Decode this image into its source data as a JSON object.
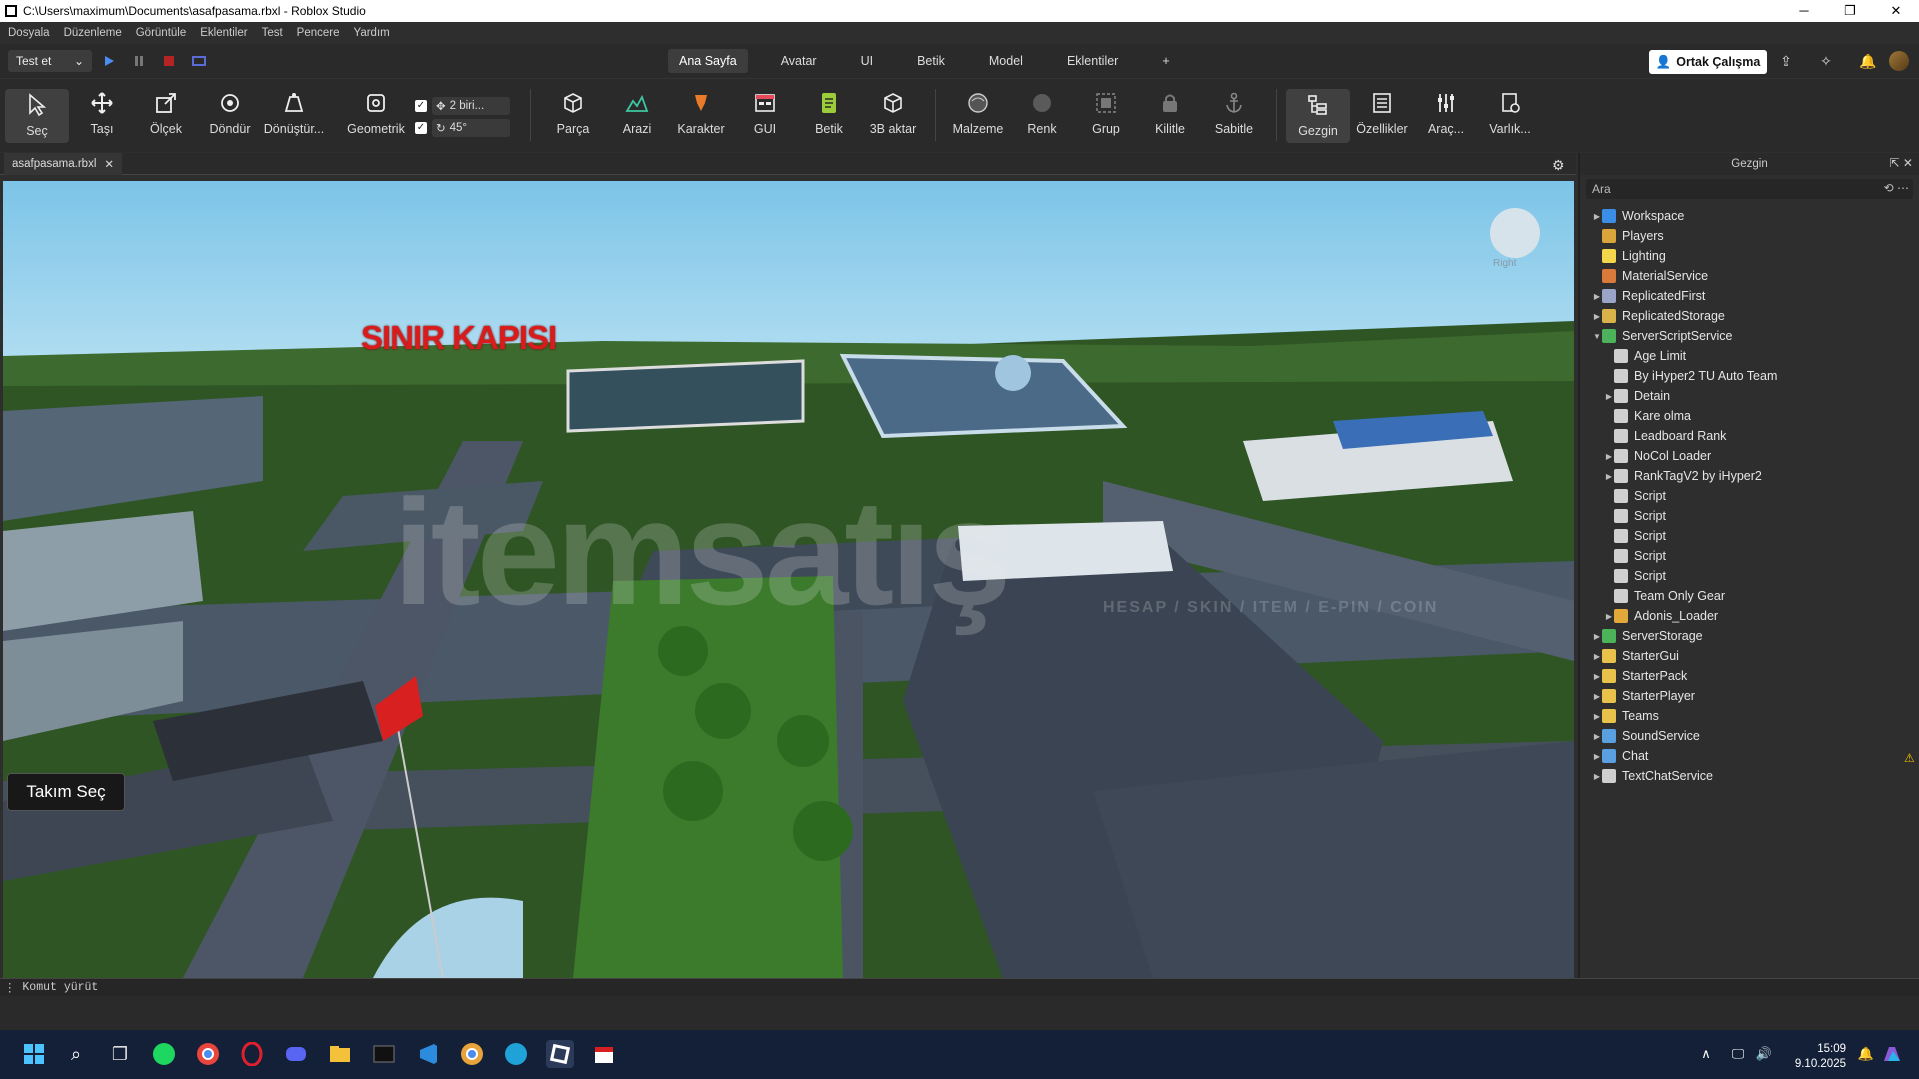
{
  "window": {
    "title": "C:\\Users\\maximum\\Documents\\asafpasama.rbxl - Roblox Studio",
    "min": "─",
    "max": "❐",
    "close": "✕"
  },
  "menu": [
    "Dosyala",
    "Düzenleme",
    "Görüntüle",
    "Eklentiler",
    "Test",
    "Pencere",
    "Yardım"
  ],
  "topbar": {
    "test_dropdown": "Test et",
    "tabs": [
      "Ana Sayfa",
      "Avatar",
      "UI",
      "Betik",
      "Model",
      "Eklentiler",
      "+"
    ],
    "active_tab": "Ana Sayfa",
    "collab_button": "Ortak Çalışma"
  },
  "ribbon": {
    "tools": [
      "Seç",
      "Taşı",
      "Ölçek",
      "Döndür",
      "Dönüştür...",
      "Geometrik"
    ],
    "snap": {
      "move_value": "2 biri...",
      "rotate_value": "45°"
    },
    "insert": [
      "Parça",
      "Arazi",
      "Karakter",
      "GUI",
      "Betik",
      "3B aktar"
    ],
    "edit": [
      "Malzeme",
      "Renk",
      "Grup",
      "Kilitle",
      "Sabitle"
    ],
    "panels": [
      "Gezgin",
      "Özellikler",
      "Araç...",
      "Varlık..."
    ]
  },
  "document_tab": {
    "name": "asafpasama.rbxl",
    "close": "✕"
  },
  "viewport": {
    "sign_text": "SINIR KAPISI",
    "team_button": "Takım Seç",
    "watermark": "itemsatış",
    "watermark_sub": "HESAP / SKIN / ITEM / E-PIN / COIN",
    "view_cube": "Right"
  },
  "explorer": {
    "title": "Gezgin",
    "search_placeholder": "Ara",
    "items": [
      {
        "label": "Workspace",
        "depth": 0,
        "arrow": "▶",
        "color": "#3a8ee6"
      },
      {
        "label": "Players",
        "depth": 0,
        "arrow": "",
        "color": "#d9a43a"
      },
      {
        "label": "Lighting",
        "depth": 0,
        "arrow": "",
        "color": "#f2d64b"
      },
      {
        "label": "MaterialService",
        "depth": 0,
        "arrow": "",
        "color": "#d87b3a"
      },
      {
        "label": "ReplicatedFirst",
        "depth": 0,
        "arrow": "▶",
        "color": "#9aa4c8"
      },
      {
        "label": "ReplicatedStorage",
        "depth": 0,
        "arrow": "▶",
        "color": "#d9b24a"
      },
      {
        "label": "ServerScriptService",
        "depth": 0,
        "arrow": "▼",
        "color": "#4db35a"
      },
      {
        "label": "Age Limit",
        "depth": 1,
        "arrow": "",
        "color": "#cfcfcf"
      },
      {
        "label": "By iHyper2 TU Auto Team",
        "depth": 1,
        "arrow": "",
        "color": "#cfcfcf"
      },
      {
        "label": "Detain",
        "depth": 1,
        "arrow": "▶",
        "color": "#cfcfcf"
      },
      {
        "label": "Kare olma",
        "depth": 1,
        "arrow": "",
        "color": "#cfcfcf"
      },
      {
        "label": "Leadboard Rank",
        "depth": 1,
        "arrow": "",
        "color": "#cfcfcf"
      },
      {
        "label": "NoCol Loader",
        "depth": 1,
        "arrow": "▶",
        "color": "#cfcfcf"
      },
      {
        "label": "RankTagV2 by iHyper2",
        "depth": 1,
        "arrow": "▶",
        "color": "#cfcfcf"
      },
      {
        "label": "Script",
        "depth": 1,
        "arrow": "",
        "color": "#cfcfcf"
      },
      {
        "label": "Script",
        "depth": 1,
        "arrow": "",
        "color": "#cfcfcf"
      },
      {
        "label": "Script",
        "depth": 1,
        "arrow": "",
        "color": "#cfcfcf"
      },
      {
        "label": "Script",
        "depth": 1,
        "arrow": "",
        "color": "#cfcfcf"
      },
      {
        "label": "Script",
        "depth": 1,
        "arrow": "",
        "color": "#cfcfcf"
      },
      {
        "label": "Team Only Gear",
        "depth": 1,
        "arrow": "",
        "color": "#cfcfcf"
      },
      {
        "label": "Adonis_Loader",
        "depth": 1,
        "arrow": "▶",
        "color": "#e0a93a"
      },
      {
        "label": "ServerStorage",
        "depth": 0,
        "arrow": "▶",
        "color": "#4db35a"
      },
      {
        "label": "StarterGui",
        "depth": 0,
        "arrow": "▶",
        "color": "#e8c24a"
      },
      {
        "label": "StarterPack",
        "depth": 0,
        "arrow": "▶",
        "color": "#e8c24a"
      },
      {
        "label": "StarterPlayer",
        "depth": 0,
        "arrow": "▶",
        "color": "#e8c24a"
      },
      {
        "label": "Teams",
        "depth": 0,
        "arrow": "▶",
        "color": "#e8c24a"
      },
      {
        "label": "SoundService",
        "depth": 0,
        "arrow": "▶",
        "color": "#5aa0e0"
      },
      {
        "label": "Chat",
        "depth": 0,
        "arrow": "▶",
        "color": "#5aa0e0"
      },
      {
        "label": "TextChatService",
        "depth": 0,
        "arrow": "▶",
        "color": "#cfcfcf"
      }
    ]
  },
  "command_bar": {
    "placeholder": "Komut yürüt"
  },
  "taskbar": {
    "time": "15:09",
    "date": "9.10.2025"
  }
}
